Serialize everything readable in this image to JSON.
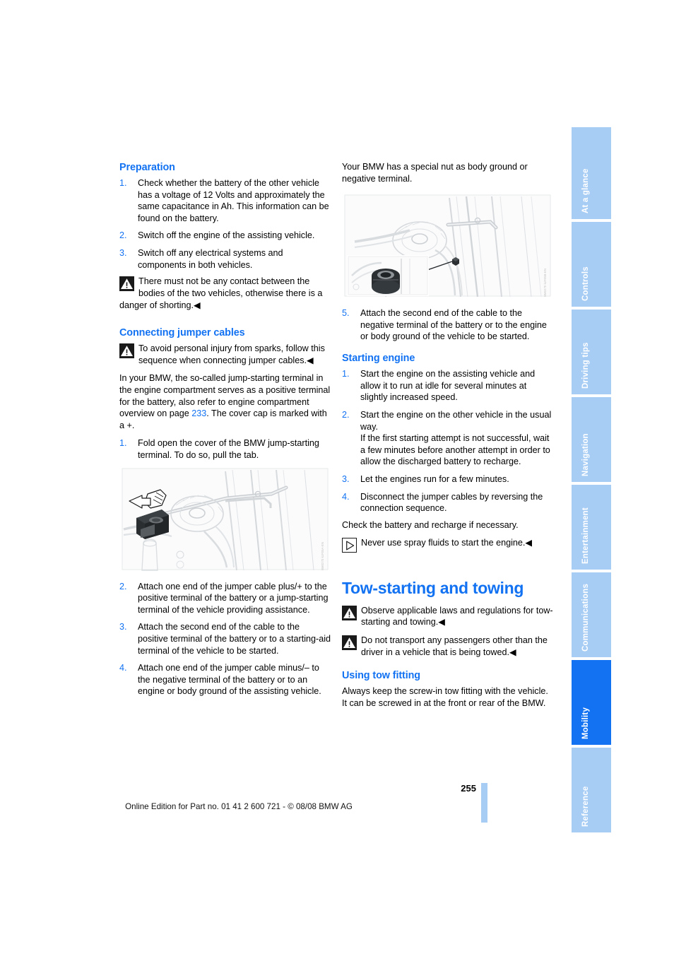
{
  "document": {
    "page_number": "255",
    "footer_text": "Online Edition for Part no. 01 41 2 600 721 - © 08/08 BMW AG"
  },
  "side_tabs": {
    "active": "Mobility",
    "items": [
      {
        "label": "At a glance"
      },
      {
        "label": "Controls"
      },
      {
        "label": "Driving tips"
      },
      {
        "label": "Navigation"
      },
      {
        "label": "Entertainment"
      },
      {
        "label": "Communications"
      },
      {
        "label": "Mobility"
      },
      {
        "label": "Reference"
      }
    ]
  },
  "left_column": {
    "preparation": {
      "heading": "Preparation",
      "steps": [
        {
          "num": "1.",
          "text": "Check whether the battery of the other vehicle has a voltage of 12 Volts and approximately the same capacitance in Ah. This information can be found on the battery."
        },
        {
          "num": "2.",
          "text": "Switch off the engine of the assisting vehicle."
        },
        {
          "num": "3.",
          "text": "Switch off any electrical systems and components in both vehicles."
        }
      ],
      "warning": {
        "icon": "warning-triangle-icon",
        "text": "There must not be any contact between the bodies of the two vehicles, otherwise there is a danger of shorting.",
        "endmark": "◀"
      }
    },
    "connecting_jumper_cables": {
      "heading": "Connecting jumper cables",
      "warning": {
        "icon": "warning-triangle-icon",
        "text": "To avoid personal injury from sparks, follow this sequence when connecting jumper cables.",
        "endmark": "◀"
      },
      "paragraph_pre": "In your BMW, the so-called jump-starting terminal in the engine compartment serves as a positive terminal for the battery, also refer to engine compartment overview on page ",
      "page_ref": "233",
      "paragraph_post": ". The cover cap is marked with a +.",
      "step1": {
        "num": "1.",
        "text": "Fold open the cover of the BMW jump-starting terminal. To do so, pull the tab."
      },
      "figure": {
        "name": "engine-compartment-jump-terminal-illustration",
        "code": "BM0270_kzF05A-EN"
      },
      "steps_after_figure": [
        {
          "num": "2.",
          "text": "Attach one end of the jumper cable plus/+ to the positive terminal of the battery or a jump-starting terminal of the vehicle providing assistance."
        },
        {
          "num": "3.",
          "text": "Attach the second end of the cable to the positive terminal of the battery or to a starting-aid terminal of the vehicle to be started."
        },
        {
          "num": "4.",
          "text": "Attach one end of the jumper cable minus/– to the negative terminal of the battery or to an engine or body ground of the assisting vehicle."
        }
      ]
    }
  },
  "right_column": {
    "intro_paragraph": "Your BMW has a special nut as body ground or negative terminal.",
    "figure": {
      "name": "body-ground-nut-illustration",
      "code": "BM0270_kzF05B-EN"
    },
    "step5": {
      "num": "5.",
      "text": "Attach the second end of the cable to the negative terminal of the battery or to the engine or body ground of the vehicle to be started."
    },
    "starting_engine": {
      "heading": "Starting engine",
      "steps": [
        {
          "num": "1.",
          "text": "Start the engine on the assisting vehicle and allow it to run at idle for several minutes at slightly increased speed."
        },
        {
          "num": "2.",
          "text": "Start the engine on the other vehicle in the usual way.",
          "subtext": "If the first starting attempt is not successful, wait a few minutes before another attempt in order to allow the discharged battery to recharge."
        },
        {
          "num": "3.",
          "text": "Let the engines run for a few minutes."
        },
        {
          "num": "4.",
          "text": "Disconnect the jumper cables by reversing the connection sequence."
        }
      ],
      "closing_paragraph": "Check the battery and recharge if necessary.",
      "note": {
        "icon": "note-triangle-icon",
        "text": "Never use spray fluids to start the engine.",
        "endmark": "◀"
      }
    },
    "tow_starting": {
      "heading": "Tow-starting and towing",
      "warnings": [
        {
          "icon": "warning-triangle-icon",
          "text": "Observe applicable laws and regulations for tow-starting and towing.",
          "endmark": "◀"
        },
        {
          "icon": "warning-triangle-icon",
          "text": "Do not transport any passengers other than the driver in a vehicle that is being towed.",
          "endmark": "◀"
        }
      ]
    },
    "using_tow_fitting": {
      "heading": "Using tow fitting",
      "paragraph": "Always keep the screw-in tow fitting with the vehicle. It can be screwed in at the front or rear of the BMW."
    }
  },
  "colors": {
    "accent_blue": "#1272f2",
    "tab_blue": "#a8cdf5"
  }
}
